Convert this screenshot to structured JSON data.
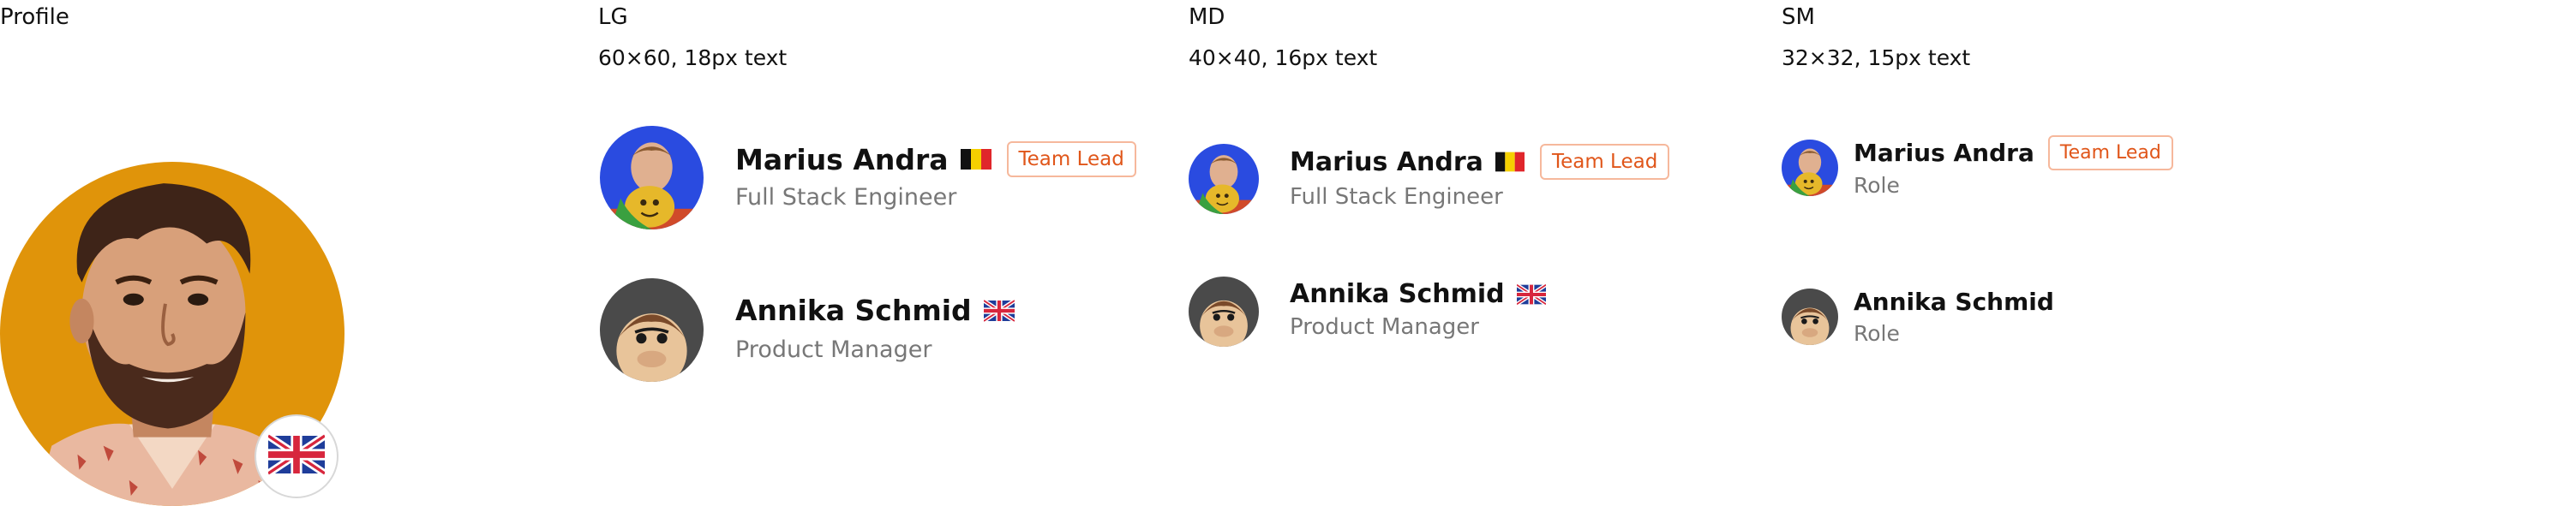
{
  "profile": {
    "title": "Profile",
    "flag_icon": "uk-flag-icon"
  },
  "sizes": {
    "lg": {
      "title": "LG",
      "subtitle": "60×60, 18px text"
    },
    "md": {
      "title": "MD",
      "subtitle": "40×40, 16px text"
    },
    "sm": {
      "title": "SM",
      "subtitle": "32×32, 15px text"
    }
  },
  "people": {
    "marius": {
      "name": "Marius Andra",
      "role": "Full Stack Engineer",
      "badge": "Team Lead",
      "flag": "belgium-flag-icon"
    },
    "annika": {
      "name": "Annika Schmid",
      "role": "Product Manager",
      "flag": "uk-flag-icon"
    }
  },
  "sm_role_placeholder": "Role",
  "colors": {
    "badge_text": "#e0561a",
    "badge_border": "#f6b89c",
    "secondary_text": "#777777",
    "profile_bg": "#e0940a",
    "marius_bg": "#2a4be0",
    "annika_bg": "#4a4a4a"
  }
}
